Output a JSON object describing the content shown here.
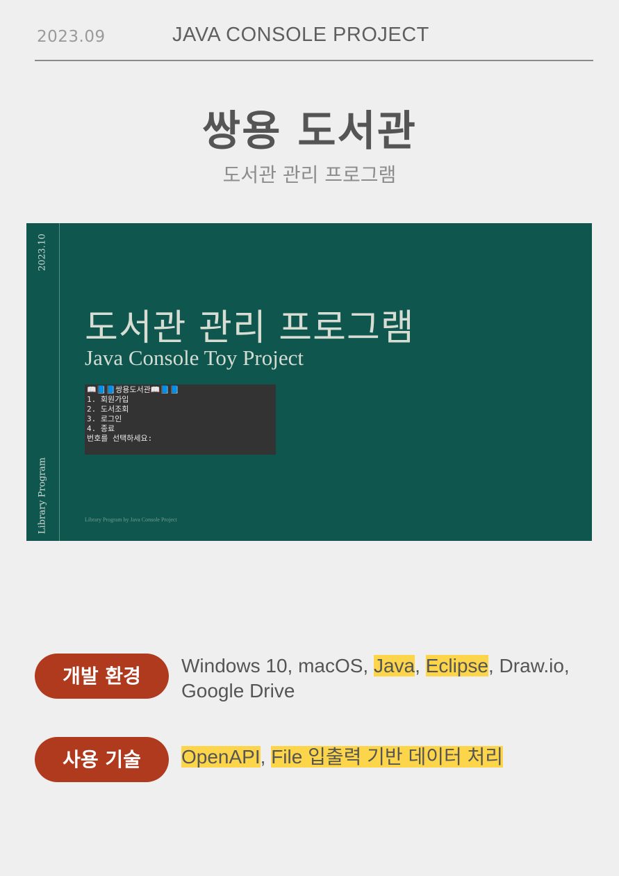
{
  "header": {
    "date": "2023.09",
    "project_label": "JAVA CONSOLE PROJECT"
  },
  "title": "쌍용 도서관",
  "subtitle": "도서관 관리 프로그램",
  "banner": {
    "side_date": "2023.10",
    "side_label": "Library Program",
    "title": "도서관 관리 프로그램",
    "subtitle": "Java Console Toy Project",
    "console_lines": [
      "📖📘📘쌍용도서관📖📘📘",
      "1. 회원가입",
      "2. 도서조회",
      "3. 로그인",
      "4. 종료",
      "번호를 선택하세요:"
    ],
    "footer": "Library Program by Java Console Project"
  },
  "dev_env": {
    "label": "개발 환경",
    "items": [
      {
        "text": "Windows 10, macOS, ",
        "highlight": false
      },
      {
        "text": "Java",
        "highlight": true
      },
      {
        "text": ", ",
        "highlight": false
      },
      {
        "text": "Eclipse",
        "highlight": true
      },
      {
        "text": ", Draw.io, Google Drive",
        "highlight": false
      }
    ]
  },
  "tech": {
    "label": "사용 기술",
    "items": [
      {
        "text": "OpenAPI",
        "highlight": true
      },
      {
        "text": ", ",
        "highlight": false
      },
      {
        "text": "File 입출력 기반 데이터 처리",
        "highlight": true
      }
    ]
  },
  "colors": {
    "background": "#efefef",
    "banner": "#0f574e",
    "pill": "#b03a1e",
    "highlight": "#fdd54a"
  }
}
